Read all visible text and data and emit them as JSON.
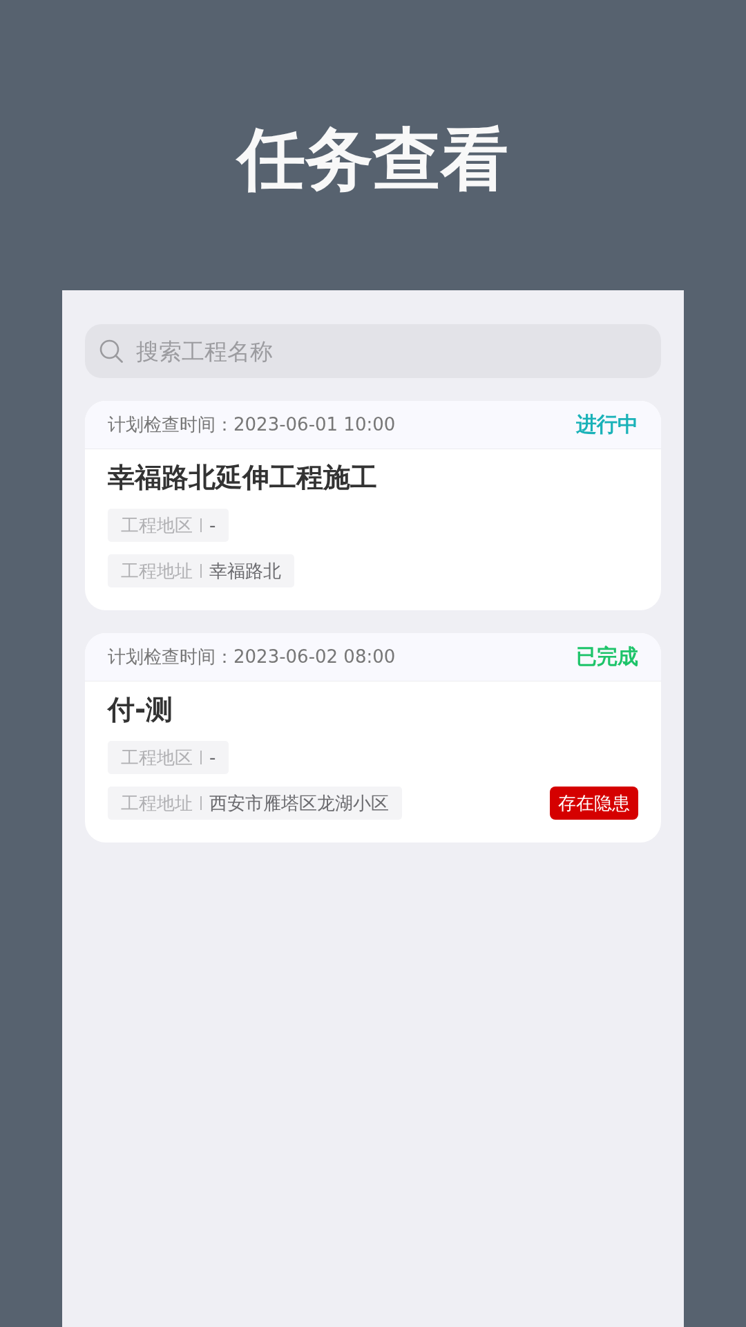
{
  "header": {
    "title": "任务查看"
  },
  "search": {
    "placeholder": "搜索工程名称"
  },
  "tasks": [
    {
      "schedule": "计划检查时间：2023-06-01 10:00",
      "status": {
        "text": "进行中",
        "color": "#1ab2b8"
      },
      "name": "幸福路北延伸工程施工",
      "fields": [
        {
          "label": "工程地区",
          "value": "-"
        },
        {
          "label": "工程地址",
          "value": "幸福路北"
        }
      ]
    },
    {
      "schedule": "计划检查时间：2023-06-02 08:00",
      "status": {
        "text": "已完成",
        "color": "#1ec46a"
      },
      "name": "付-测",
      "fields": [
        {
          "label": "工程地区",
          "value": "-"
        },
        {
          "label": "工程地址",
          "value": "西安市雁塔区龙湖小区"
        }
      ],
      "hazard": "存在隐患"
    }
  ]
}
